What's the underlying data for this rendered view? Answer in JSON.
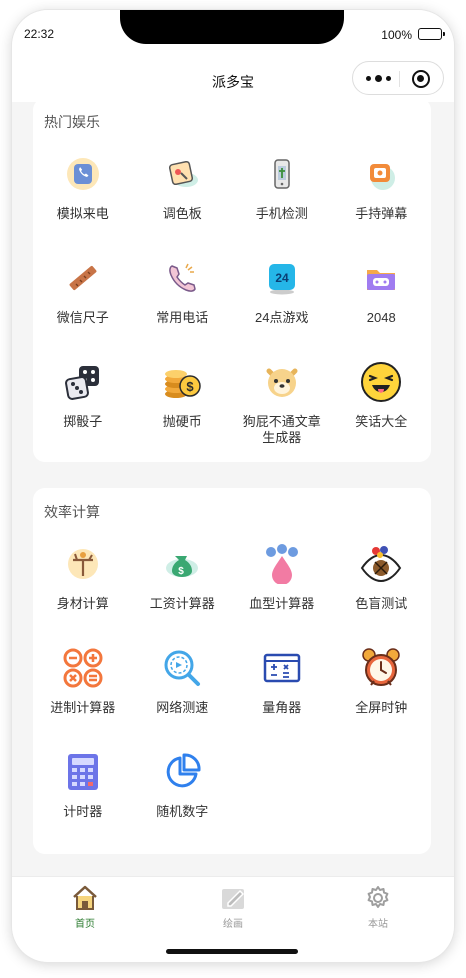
{
  "status_bar": {
    "time": "22:32",
    "battery": "100%"
  },
  "nav": {
    "title": "派多宝"
  },
  "sections": [
    {
      "title": "热门娱乐",
      "items": [
        {
          "label": "模拟来电",
          "icon": "phone-call-icon"
        },
        {
          "label": "调色板",
          "icon": "palette-icon"
        },
        {
          "label": "手机检测",
          "icon": "phone-check-icon"
        },
        {
          "label": "手持弹幕",
          "icon": "barrage-icon"
        },
        {
          "label": "微信尺子",
          "icon": "ruler-icon"
        },
        {
          "label": "常用电话",
          "icon": "telephone-icon"
        },
        {
          "label": "24点游戏",
          "icon": "game-24-icon"
        },
        {
          "label": "2048",
          "icon": "game-2048-icon"
        },
        {
          "label": "掷骰子",
          "icon": "dice-icon"
        },
        {
          "label": "抛硬币",
          "icon": "coin-icon"
        },
        {
          "label": "狗屁不通文章生成器",
          "icon": "doge-icon"
        },
        {
          "label": "笑话大全",
          "icon": "joke-emoji-icon"
        }
      ]
    },
    {
      "title": "效率计算",
      "items": [
        {
          "label": "身材计算",
          "icon": "body-calc-icon"
        },
        {
          "label": "工资计算器",
          "icon": "salary-icon"
        },
        {
          "label": "血型计算器",
          "icon": "blood-type-icon"
        },
        {
          "label": "色盲测试",
          "icon": "eye-icon"
        },
        {
          "label": "进制计算器",
          "icon": "base-calculator-icon"
        },
        {
          "label": "网络测速",
          "icon": "network-speed-icon"
        },
        {
          "label": "量角器",
          "icon": "protractor-icon"
        },
        {
          "label": "全屏时钟",
          "icon": "alarm-clock-icon"
        },
        {
          "label": "计时器",
          "icon": "calculator-icon"
        },
        {
          "label": "随机数字",
          "icon": "pie-chart-icon"
        }
      ]
    }
  ],
  "tabbar": {
    "tabs": [
      {
        "label": "首页",
        "icon": "home-icon",
        "active": true
      },
      {
        "label": "绘画",
        "icon": "drawing-icon",
        "active": false
      },
      {
        "label": "本站",
        "icon": "gear-icon",
        "active": false
      }
    ],
    "active_color": "#2e7d32",
    "inactive_color": "#999999"
  }
}
